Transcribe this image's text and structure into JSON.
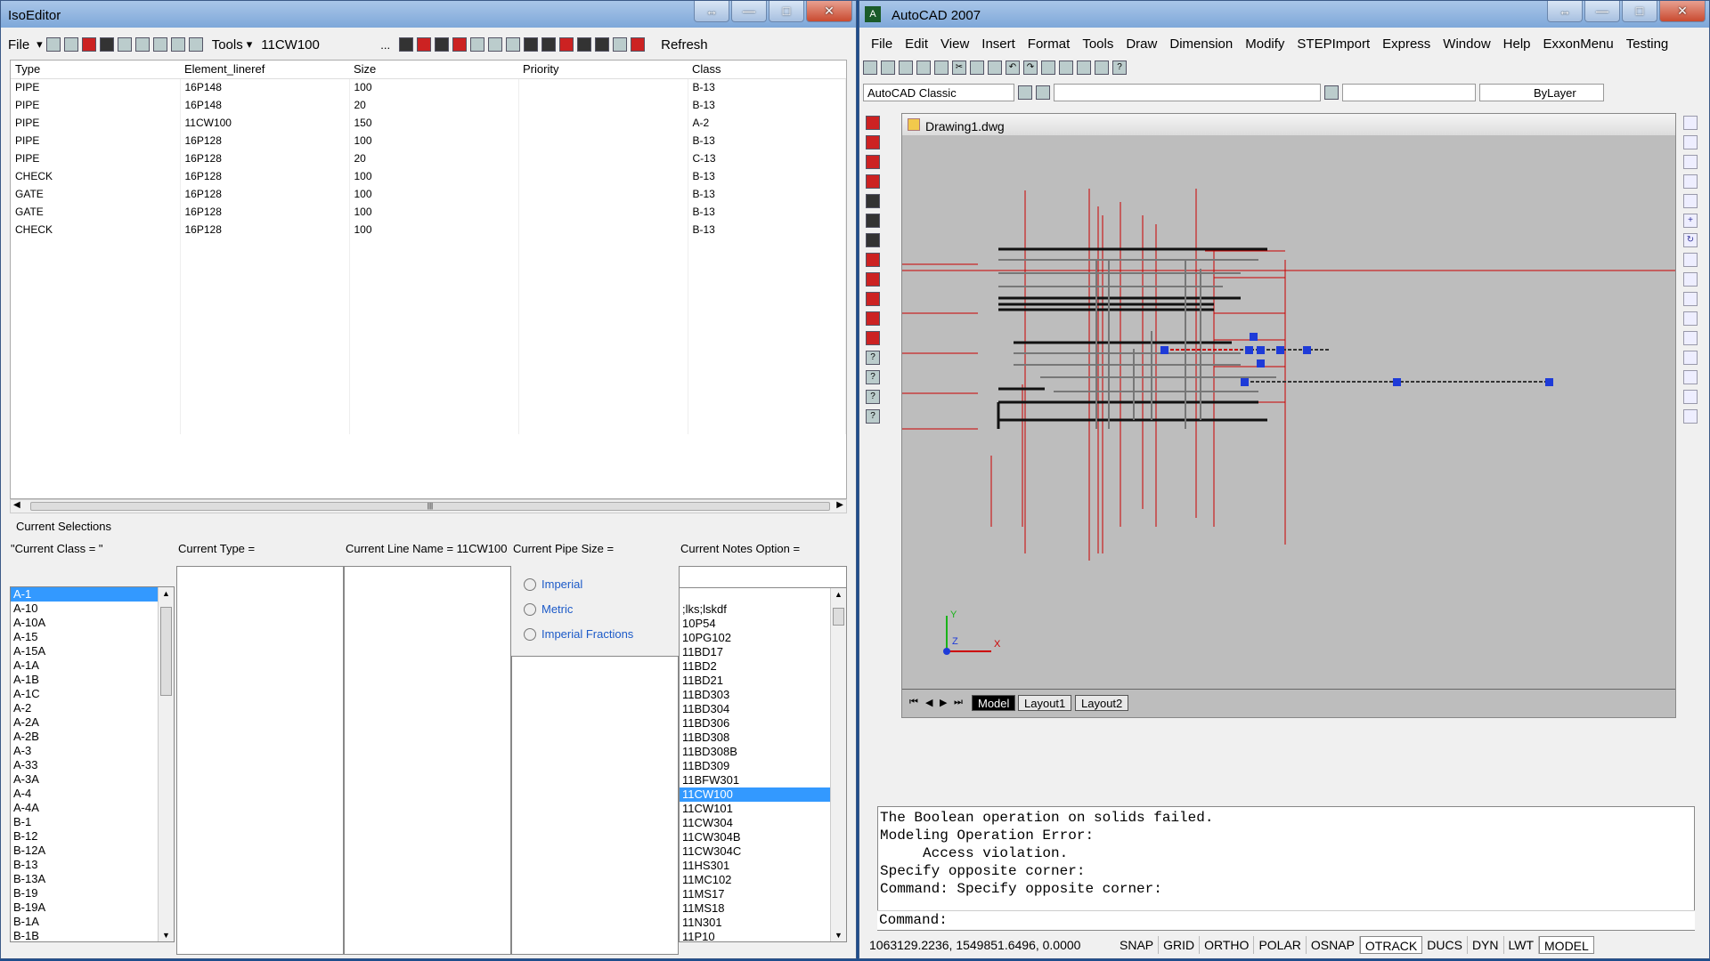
{
  "iso_editor": {
    "title": "IsoEditor",
    "toolbar": {
      "file_label": "File",
      "tools_label": "Tools",
      "line_value": "11CW100",
      "ellipsis": "...",
      "refresh_label": "Refresh"
    },
    "grid": {
      "headers": [
        "Type",
        "Element_lineref",
        "Size",
        "Priority",
        "Class"
      ],
      "rows": [
        [
          "PIPE",
          "16P148",
          "100",
          "",
          "B-13"
        ],
        [
          "PIPE",
          "16P148",
          "20",
          "",
          "B-13"
        ],
        [
          "PIPE",
          "11CW100",
          "150",
          "",
          "A-2"
        ],
        [
          "PIPE",
          "16P128",
          "100",
          "",
          "B-13"
        ],
        [
          "PIPE",
          "16P128",
          "20",
          "",
          "C-13"
        ],
        [
          "CHECK",
          "16P128",
          "100",
          "",
          "B-13"
        ],
        [
          "GATE",
          "16P128",
          "100",
          "",
          "B-13"
        ],
        [
          "GATE",
          "16P128",
          "100",
          "",
          "B-13"
        ],
        [
          "CHECK",
          "16P128",
          "100",
          "",
          "B-13"
        ]
      ]
    },
    "selections": {
      "heading": "Current Selections",
      "class_label": "\"Current Class = \"",
      "type_label": "Current Type =",
      "line_label": "Current Line Name = 11CW100",
      "size_label": "Current Pipe Size =",
      "notes_label": "Current Notes Option ="
    },
    "class_list": [
      "A-1",
      "A-10",
      "A-10A",
      "A-15",
      "A-15A",
      "A-1A",
      "A-1B",
      "A-1C",
      "A-2",
      "A-2A",
      "A-2B",
      "A-3",
      "A-33",
      "A-3A",
      "A-4",
      "A-4A",
      "B-1",
      "B-12",
      "B-12A",
      "B-13",
      "B-13A",
      "B-19",
      "B-19A",
      "B-1A",
      "B-1B"
    ],
    "class_selected": "A-1",
    "units": [
      "Imperial",
      "Metric",
      "Imperial Fractions"
    ],
    "notes_list": [
      ";lks;lskdf",
      "10P54",
      "10PG102",
      "11BD17",
      "11BD2",
      "11BD21",
      "11BD303",
      "11BD304",
      "11BD306",
      "11BD308",
      "11BD308B",
      "11BD309",
      "11BFW301",
      "11CW100",
      "11CW101",
      "11CW304",
      "11CW304B",
      "11CW304C",
      "11HS301",
      "11MC102",
      "11MS17",
      "11MS18",
      "11N301",
      "11P10"
    ],
    "notes_selected": "11CW100"
  },
  "autocad": {
    "title": "AutoCAD 2007",
    "menu": [
      "File",
      "Edit",
      "View",
      "Insert",
      "Format",
      "Tools",
      "Draw",
      "Dimension",
      "Modify",
      "STEPImport",
      "Express",
      "Window",
      "Help",
      "ExxonMenu",
      "Testing"
    ],
    "workspace": "AutoCAD Classic",
    "linetype": "ByLayer",
    "drawing_title": "Drawing1.dwg",
    "layout_tabs": [
      "Model",
      "Layout1",
      "Layout2"
    ],
    "command_history": [
      "The Boolean operation on solids failed.",
      "Modeling Operation Error:",
      "     Access violation.",
      "Specify opposite corner:",
      "Command: Specify opposite corner:"
    ],
    "command_prompt": "Command:",
    "coords": "1063129.2236, 1549851.6496, 0.0000",
    "status_buttons": [
      "SNAP",
      "GRID",
      "ORTHO",
      "POLAR",
      "OSNAP",
      "OTRACK",
      "DUCS",
      "DYN",
      "LWT",
      "MODEL"
    ],
    "ucs": {
      "y": "Y",
      "x": "X",
      "z": "Z"
    }
  }
}
